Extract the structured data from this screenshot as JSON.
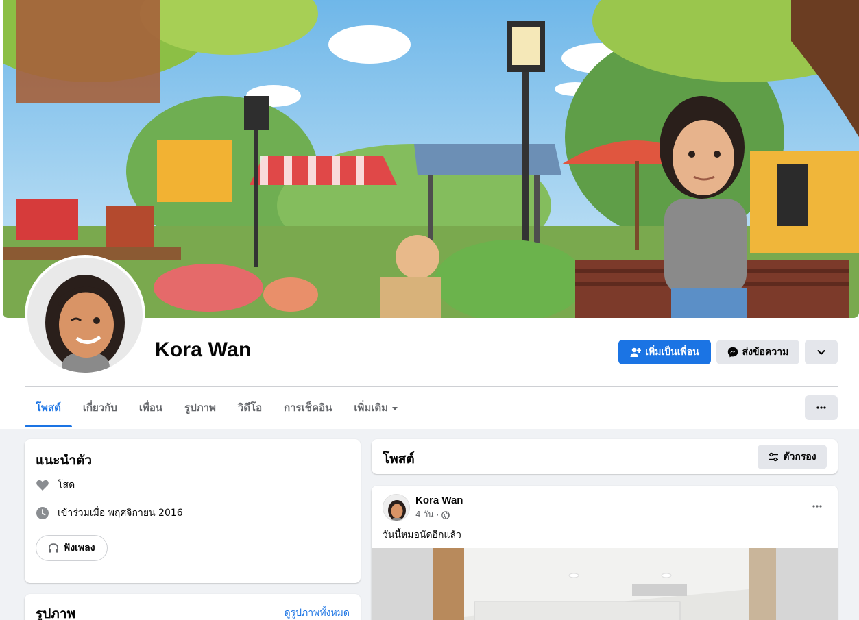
{
  "profile": {
    "name": "Kora Wan",
    "add_friend_label": "เพิ่มเป็นเพื่อน",
    "message_label": "ส่งข้อความ"
  },
  "tabs": [
    {
      "label": "โพสต์",
      "active": true
    },
    {
      "label": "เกี่ยวกับ",
      "active": false
    },
    {
      "label": "เพื่อน",
      "active": false
    },
    {
      "label": "รูปภาพ",
      "active": false
    },
    {
      "label": "วิดีโอ",
      "active": false
    },
    {
      "label": "การเช็คอิน",
      "active": false
    },
    {
      "label": "เพิ่มเติม",
      "active": false
    }
  ],
  "intro": {
    "title": "แนะนำตัว",
    "relationship": "โสด",
    "joined": "เข้าร่วมเมื่อ พฤศจิกายน 2016",
    "music_label": "ฟังเพลง"
  },
  "photos": {
    "title": "รูปภาพ",
    "see_all": "ดูรูปภาพทั้งหมด"
  },
  "posts_header": {
    "title": "โพสต์",
    "filter_label": "ตัวกรอง"
  },
  "post": {
    "author": "Kora Wan",
    "time": "4 วัน",
    "separator": "·",
    "text": "วันนี้หมอนัดอีกแล้ว"
  },
  "colors": {
    "accent": "#1b74e4",
    "secondary_button": "#e4e6eb",
    "page_bg": "#f0f2f5",
    "muted_text": "#65676b"
  }
}
